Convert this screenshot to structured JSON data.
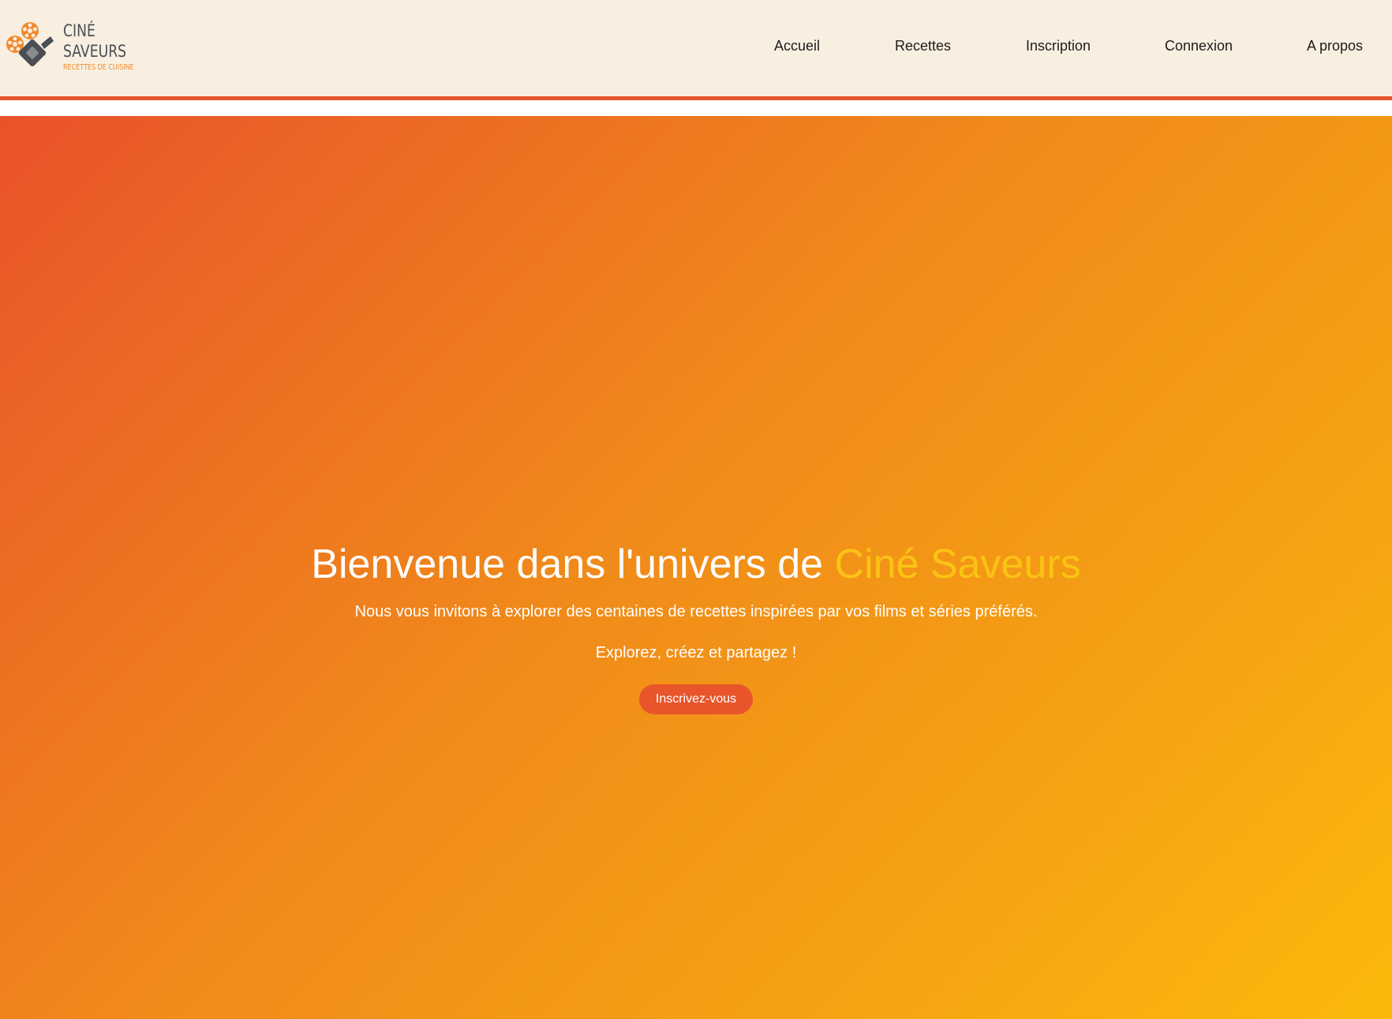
{
  "brand": {
    "line1": "CINÉ",
    "line2": "SAVEURS",
    "line3": "RECETTES DE CUISINE",
    "logo_icon": "film-camera-reel-icon",
    "colors": {
      "orange": "#f08a2e",
      "dark": "#4b4f54"
    }
  },
  "nav": {
    "items": [
      {
        "label": "Accueil"
      },
      {
        "label": "Recettes"
      },
      {
        "label": "Inscription"
      },
      {
        "label": "Connexion"
      },
      {
        "label": "A propos"
      }
    ]
  },
  "hero": {
    "title_prefix": "Bienvenue dans l'univers de ",
    "title_accent": "Ciné Saveurs",
    "subtitle": "Nous vous invitons à explorer des centaines de recettes inspirées par vos films et séries préférés.",
    "tagline": "Explorez, créez et partagez !",
    "cta_label": "Inscrivez-vous"
  },
  "colors": {
    "header_bg": "#f8efe0",
    "accent_red": "#e8552b",
    "gradient_start": "#e9522a",
    "gradient_end": "#fbb90b",
    "title_accent": "#fbc314"
  }
}
